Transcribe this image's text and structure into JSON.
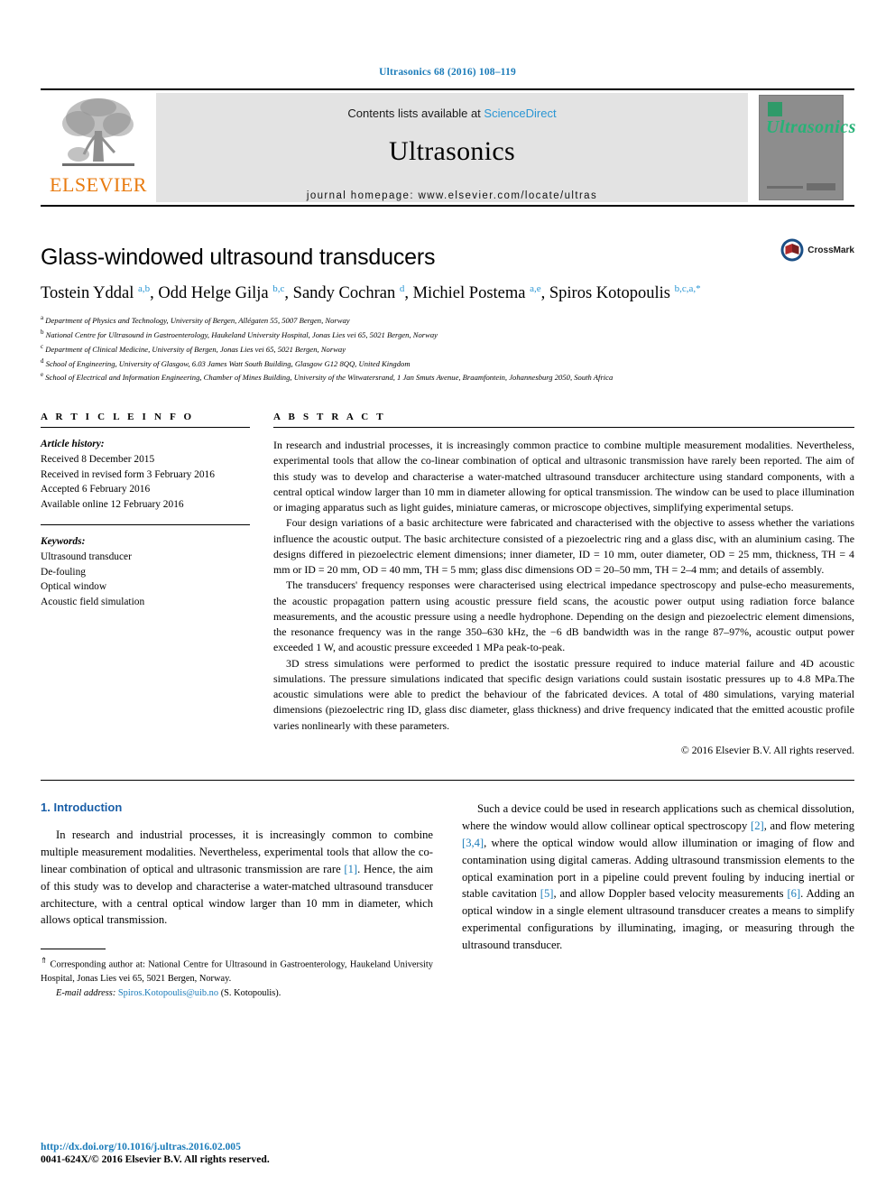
{
  "running_head": "Ultrasonics 68 (2016) 108–119",
  "masthead": {
    "contents_prefix": "Contents lists available at ",
    "sciencedirect": "ScienceDirect",
    "journal_title": "Ultrasonics",
    "homepage": "journal homepage: www.elsevier.com/locate/ultras",
    "publisher_wordmark": "ELSEVIER",
    "cover_title": "Ultrasonics",
    "accent_blue": "#2a96d4",
    "elsevier_orange": "#e87b10",
    "cover_green": "#27b277",
    "cover_grey": "#8d8d8d"
  },
  "article": {
    "title": "Glass-windowed ultrasound transducers",
    "authors_html": "Tostein Yddal <sup>a,b</sup>, Odd Helge Gilja <sup>b,c</sup>, Sandy Cochran <sup>d</sup>, Michiel Postema <sup>a,e</sup>, Spiros Kotopoulis <sup>b,c,a,*</sup>",
    "crossmark_label": "CrossMark",
    "affiliations": [
      "a Department of Physics and Technology, University of Bergen, Allégaten 55, 5007 Bergen, Norway",
      "b National Centre for Ultrasound in Gastroenterology, Haukeland University Hospital, Jonas Lies vei 65, 5021 Bergen, Norway",
      "c Department of Clinical Medicine, University of Bergen, Jonas Lies vei 65, 5021 Bergen, Norway",
      "d School of Engineering, University of Glasgow, 6.03 James Watt South Building, Glasgow G12 8QQ, United Kingdom",
      "e School of Electrical and Information Engineering, Chamber of Mines Building, University of the Witwatersrand, 1 Jan Smuts Avenue, Braamfontein, Johannesburg 2050, South Africa"
    ]
  },
  "article_info": {
    "heading": "A R T I C L E   I N F O",
    "history_label": "Article history:",
    "history": [
      "Received 8 December 2015",
      "Received in revised form 3 February 2016",
      "Accepted 6 February 2016",
      "Available online 12 February 2016"
    ],
    "keywords_label": "Keywords:",
    "keywords": [
      "Ultrasound transducer",
      "De-fouling",
      "Optical window",
      "Acoustic field simulation"
    ]
  },
  "abstract": {
    "heading": "A B S T R A C T",
    "paragraphs": [
      "In research and industrial processes, it is increasingly common practice to combine multiple measurement modalities. Nevertheless, experimental tools that allow the co-linear combination of optical and ultrasonic transmission have rarely been reported. The aim of this study was to develop and characterise a water-matched ultrasound transducer architecture using standard components, with a central optical window larger than 10 mm in diameter allowing for optical transmission. The window can be used to place illumination or imaging apparatus such as light guides, miniature cameras, or microscope objectives, simplifying experimental setups.",
      "Four design variations of a basic architecture were fabricated and characterised with the objective to assess whether the variations influence the acoustic output. The basic architecture consisted of a piezoelectric ring and a glass disc, with an aluminium casing. The designs differed in piezoelectric element dimensions; inner diameter, ID = 10 mm, outer diameter, OD = 25 mm, thickness, TH = 4 mm or ID = 20 mm, OD = 40 mm, TH = 5 mm; glass disc dimensions OD = 20–50 mm, TH = 2–4 mm; and details of assembly.",
      "The transducers' frequency responses were characterised using electrical impedance spectroscopy and pulse-echo measurements, the acoustic propagation pattern using acoustic pressure field scans, the acoustic power output using radiation force balance measurements, and the acoustic pressure using a needle hydrophone. Depending on the design and piezoelectric element dimensions, the resonance frequency was in the range 350–630 kHz, the −6 dB bandwidth was in the range 87–97%, acoustic output power exceeded 1 W, and acoustic pressure exceeded 1 MPa peak-to-peak.",
      "3D stress simulations were performed to predict the isostatic pressure required to induce material failure and 4D acoustic simulations. The pressure simulations indicated that specific design variations could sustain isostatic pressures up to 4.8 MPa.The acoustic simulations were able to predict the behaviour of the fabricated devices. A total of 480 simulations, varying material dimensions (piezoelectric ring ID, glass disc diameter, glass thickness) and drive frequency indicated that the emitted acoustic profile varies nonlinearly with these parameters."
    ],
    "copyright": "© 2016 Elsevier B.V. All rights reserved."
  },
  "body": {
    "section_title": "1. Introduction",
    "left_paragraph_html": "In research and industrial processes, it is increasingly common to combine multiple measurement modalities. Nevertheless, experimental tools that allow the co-linear combination of optical and ultrasonic transmission are rare <span class=\"cite\">[1]</span>. Hence, the aim of this study was to develop and characterise a water-matched ultrasound transducer architecture, with a central optical window larger than 10 mm in diameter, which allows optical transmission.",
    "right_paragraph_html": "Such a device could be used in research applications such as chemical dissolution, where the window would allow collinear optical spectroscopy <span class=\"cite\">[2]</span>, and flow metering <span class=\"cite\">[3,4]</span>, where the optical window would allow illumination or imaging of flow and contamination using digital cameras. Adding ultrasound transmission elements to the optical examination port in a pipeline could prevent fouling by inducing inertial or stable cavitation <span class=\"cite\">[5]</span>, and allow Doppler based velocity measurements <span class=\"cite\">[6]</span>. Adding an optical window in a single element ultrasound transducer creates a means to simplify experimental configurations by illuminating, imaging, or measuring through the ultrasound transducer."
  },
  "footnote": {
    "corresponding_html": "<sup>⇑</sup> Corresponding author at: National Centre for Ultrasound in Gastroenterology, Haukeland University Hospital, Jonas Lies vei 65, 5021 Bergen, Norway.",
    "email_label": "E-mail address:",
    "email": "Spiros.Kotopoulis@uib.no",
    "email_owner": "(S. Kotopoulis)."
  },
  "bottom": {
    "doi": "http://dx.doi.org/10.1016/j.ultras.2016.02.005",
    "issn": "0041-624X/© 2016 Elsevier B.V. All rights reserved."
  }
}
